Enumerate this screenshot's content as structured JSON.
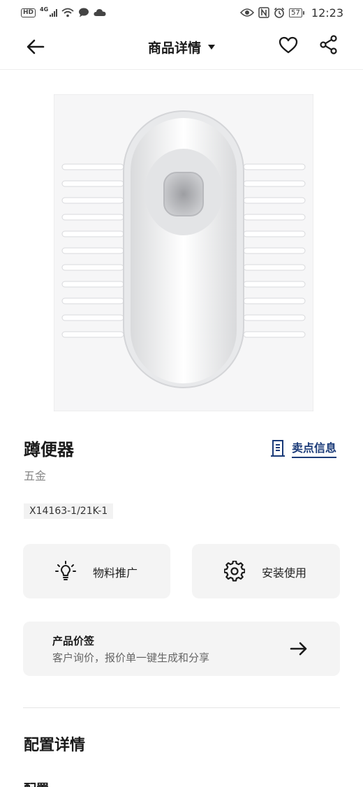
{
  "status_bar": {
    "hd_label": "HD",
    "network_label": "4G",
    "battery_level": "57",
    "time": "12:23"
  },
  "header": {
    "title": "商品详情"
  },
  "product": {
    "name": "蹲便器",
    "category": "五金",
    "model_code": "X14163-1/21K-1",
    "selling_point_label": "卖点信息"
  },
  "actions": {
    "material_label": "物料推广",
    "install_label": "安装使用"
  },
  "price_tag": {
    "title": "产品价签",
    "description": "客户询价，报价单一键生成和分享"
  },
  "details": {
    "section_title": "配置详情",
    "sub_title": "配置"
  },
  "colors": {
    "accent": "#1a3a78",
    "card_bg": "#f4f4f4"
  }
}
